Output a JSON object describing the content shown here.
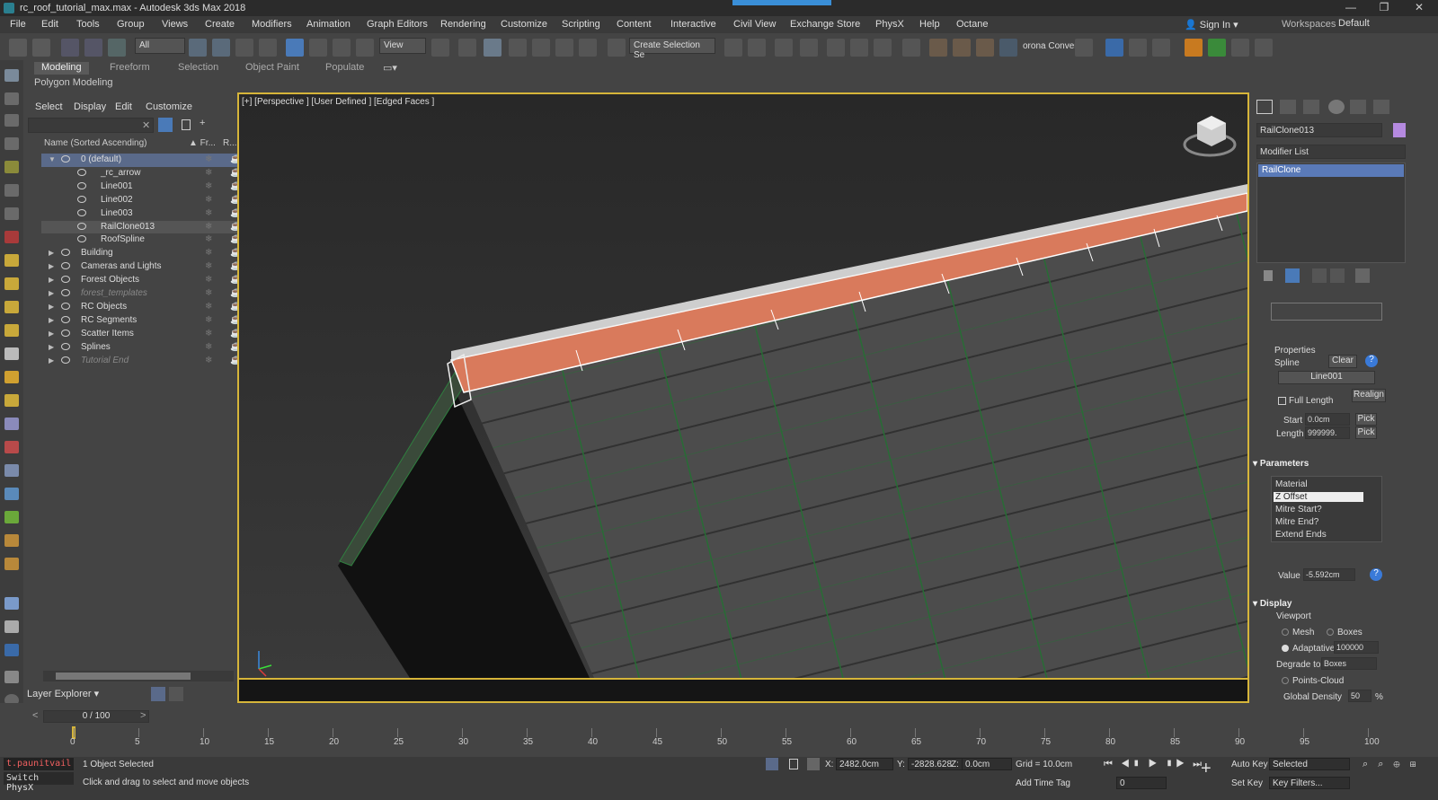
{
  "window": {
    "title": "rc_roof_tutorial_max.max - Autodesk 3ds Max 2018",
    "minimize": "—",
    "restore": "❐",
    "close": "✕"
  },
  "menu": {
    "items": [
      "File",
      "Edit",
      "Tools",
      "Group",
      "Views",
      "Create",
      "Modifiers",
      "Animation",
      "Graph Editors",
      "Rendering",
      "Customize",
      "Scripting",
      "Content",
      "Interactive",
      "Civil View",
      "Exchange Store",
      "PhysX",
      "Help",
      "Octane"
    ],
    "sign_in": "Sign In",
    "workspaces_label": "Workspaces:",
    "workspaces_value": "Default"
  },
  "toolbar": {
    "filter": "All",
    "ref_coord": "View",
    "selection_set": "Create Selection Se",
    "corona_label": "orona Convert"
  },
  "ribbon": {
    "tabs": [
      "Modeling",
      "Freeform",
      "Selection",
      "Object Paint",
      "Populate"
    ],
    "sub": "Polygon Modeling"
  },
  "explorer": {
    "menu": [
      "Select",
      "Display",
      "Edit",
      "Customize"
    ],
    "col_name": "Name (Sorted Ascending)",
    "col_frozen": "▲ Fr...",
    "col_render": "R...",
    "rows": [
      {
        "label": "0 (default)",
        "level": 0,
        "expanded": true,
        "selected": true
      },
      {
        "label": "_rc_arrow",
        "level": 2
      },
      {
        "label": "Line001",
        "level": 2
      },
      {
        "label": "Line002",
        "level": 2
      },
      {
        "label": "Line003",
        "level": 2
      },
      {
        "label": "RailClone013",
        "level": 2,
        "highlighted": true
      },
      {
        "label": "RoofSpline",
        "level": 2
      },
      {
        "label": "Building",
        "level": 0
      },
      {
        "label": "Cameras and Lights",
        "level": 0
      },
      {
        "label": "Forest Objects",
        "level": 0
      },
      {
        "label": "forest_templates",
        "level": 0,
        "dim": true
      },
      {
        "label": "RC Objects",
        "level": 0
      },
      {
        "label": "RC Segments",
        "level": 0
      },
      {
        "label": "Scatter Items",
        "level": 0
      },
      {
        "label": "Splines",
        "level": 0
      },
      {
        "label": "Tutorial End",
        "level": 0,
        "dim": true
      }
    ],
    "layer_explorer": "Layer Explorer"
  },
  "viewport": {
    "label": "[+] [Perspective ] [User Defined ] [Edged Faces ]"
  },
  "command_panel": {
    "object_name": "RailClone013",
    "modifier_list": "Modifier List",
    "stack_item": "RailClone",
    "properties_title": "Properties",
    "spline_label": "Spline",
    "clear_button": "Clear",
    "spline_value": "Line001",
    "realign_button": "Realign",
    "full_length": "Full Length",
    "start_label": "Start",
    "start_value": "0.0cm",
    "length_label": "Length",
    "length_value": "999999.",
    "pick": "Pick",
    "parameters_title": "Parameters",
    "params": [
      "Material",
      "Z Offset",
      "Mitre Start?",
      "Mitre End?",
      "Extend Ends"
    ],
    "value_label": "Value",
    "value": "-5.592cm",
    "display_title": "Display",
    "viewport_label": "Viewport",
    "mesh": "Mesh",
    "boxes": "Boxes",
    "adaptative": "Adaptative",
    "adaptative_value": "100000",
    "degrade_label": "Degrade to",
    "degrade_value": "Boxes",
    "points_cloud": "Points-Cloud",
    "global_density": "Global Density",
    "density_value": "50",
    "percent": "%"
  },
  "timeline": {
    "slider": "0 / 100",
    "ticks": [
      "0",
      "5",
      "10",
      "15",
      "20",
      "25",
      "30",
      "35",
      "40",
      "45",
      "50",
      "55",
      "60",
      "65",
      "70",
      "75",
      "80",
      "85",
      "90",
      "95",
      "100"
    ]
  },
  "status": {
    "user": "t.paunitvail",
    "switch_physx": "Switch PhysX",
    "selected": "1 Object Selected",
    "hint": "Click and drag to select and move objects",
    "x_label": "X:",
    "x_value": "2482.0cm",
    "y_label": "Y:",
    "y_value": "-2828.628",
    "z_label": "Z:",
    "z_value": "0.0cm",
    "grid": "Grid = 10.0cm",
    "add_time_tag": "Add Time Tag",
    "auto_key": "Auto Key",
    "set_key": "Set Key",
    "selected_dd": "Selected",
    "key_filters": "Key Filters...",
    "frame": "0"
  },
  "colors": {
    "viewport_border": "#d6b53a",
    "selection_blue": "#5a7ab8",
    "ridge_orange": "#d97a5c"
  }
}
